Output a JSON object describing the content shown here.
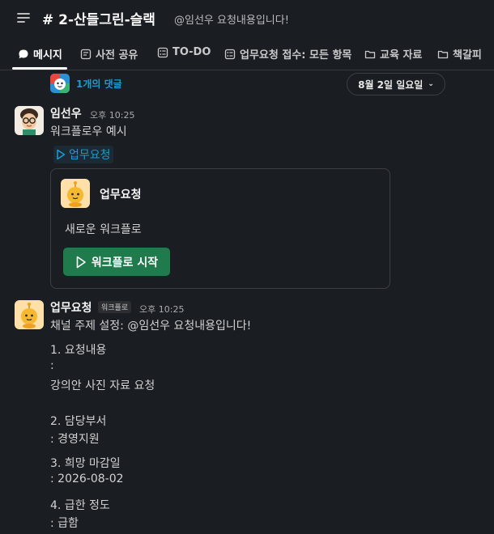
{
  "header": {
    "channel_title": "# 2-산들그린-슬랙",
    "topic": "@임선우 요청내용입니다!"
  },
  "tabs": [
    {
      "label": "메시지",
      "icon": "message-icon",
      "active": true
    },
    {
      "label": "사전 공유",
      "icon": "canvas-icon"
    },
    {
      "label": "TO-DO",
      "icon": "list-icon"
    },
    {
      "label": "업무요청 접수: 모든 항목",
      "icon": "list-icon"
    },
    {
      "label": "교육 자료",
      "icon": "folder-icon"
    },
    {
      "label": "책갈피",
      "icon": "folder-icon"
    }
  ],
  "thread": {
    "link": "1개의 댓글"
  },
  "date_pill": {
    "label": "8월 2일 일요일",
    "icon": "chevron-down-icon"
  },
  "message1": {
    "author": "임선우",
    "time": "오후 10:25",
    "text": "워크플로우 예시",
    "workflow_link": "업무요청",
    "card": {
      "title": "업무요청",
      "description": "새로운 워크플로",
      "button": "워크플로 시작"
    }
  },
  "message2": {
    "author": "업무요청",
    "badge": "워크플로",
    "time": "오후 10:25",
    "lines": [
      "채널 주제 설정: @임선우 요청내용입니다!",
      "1. 요청내용",
      ":",
      "강의안 사진 자료 요청",
      "2. 담당부서",
      ":  경영지원",
      "3. 희망 마감일",
      ":  2026-08-02",
      "4. 급한 정도",
      ": 급함"
    ]
  },
  "colors": {
    "background": "#1a1d21",
    "link": "#1d9bd1",
    "button": "#1f7a4c"
  }
}
